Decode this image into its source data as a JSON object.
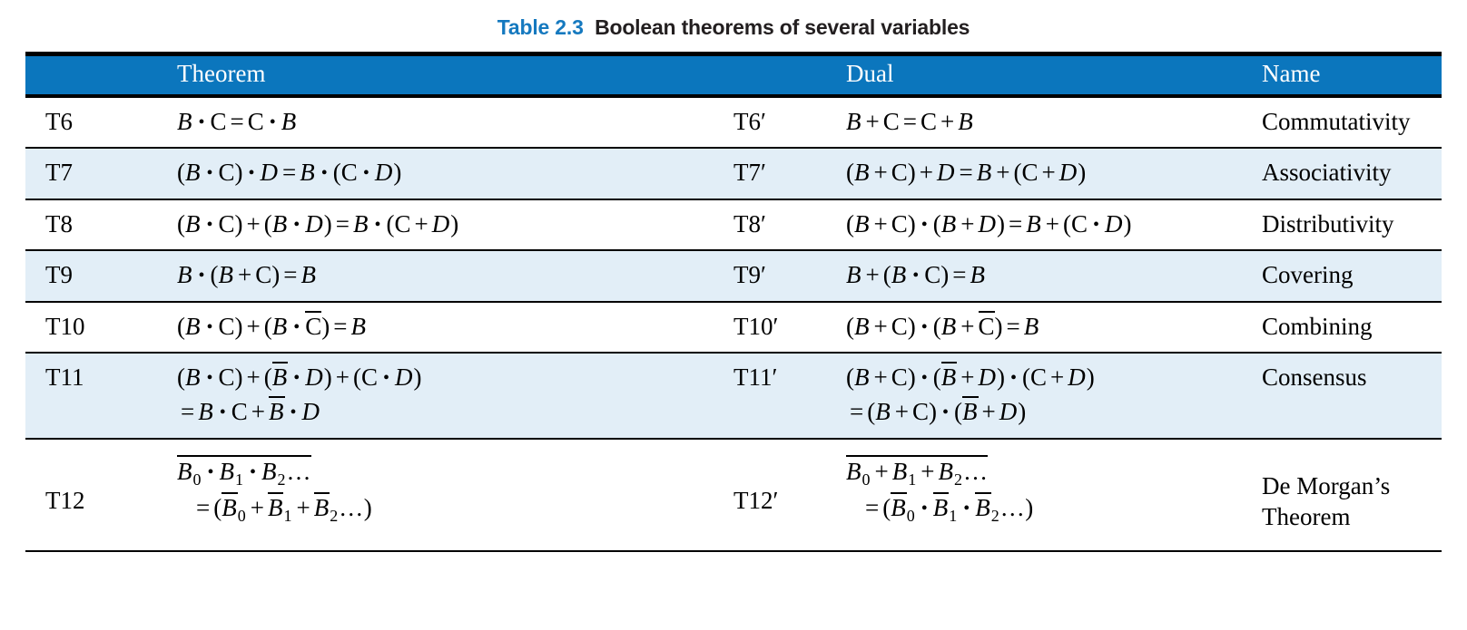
{
  "caption": {
    "number": "Table 2.3",
    "text": "Boolean theorems of several variables",
    "accent_color": "#1579bf",
    "text_color": "#231f20"
  },
  "colors": {
    "header_bg": "#0b76bd",
    "header_text": "#ffffff",
    "stripe_bg": "#e2eef7",
    "rule": "#000000",
    "body_text": "#000000"
  },
  "header": {
    "blank": "",
    "theorem": "Theorem",
    "dual_label": "",
    "dual": "Dual",
    "name": "Name"
  },
  "rows": [
    {
      "id": "T6",
      "dual_id": "T6′",
      "name": "Commutativity",
      "striped": false,
      "theorem_text": "B • C = C • B",
      "dual_text": "B + C = C + B"
    },
    {
      "id": "T7",
      "dual_id": "T7′",
      "name": "Associativity",
      "striped": true,
      "theorem_text": "(B • C) • D = B • (C • D)",
      "dual_text": "(B + C) + D = B + (C + D)"
    },
    {
      "id": "T8",
      "dual_id": "T8′",
      "name": "Distributivity",
      "striped": false,
      "theorem_text": "(B • C) + (B • D) = B • (C + D)",
      "dual_text": "(B + C) • (B + D) = B + (C • D)"
    },
    {
      "id": "T9",
      "dual_id": "T9′",
      "name": "Covering",
      "striped": true,
      "theorem_text": "B • (B + C) = B",
      "dual_text": "B + (B • C) = B"
    },
    {
      "id": "T10",
      "dual_id": "T10′",
      "name": "Combining",
      "striped": false,
      "theorem_text": "(B • C) + (B • C̅) = B",
      "dual_text": "(B + C) • (B + C̅) = B"
    },
    {
      "id": "T11",
      "dual_id": "T11′",
      "name": "Consensus",
      "striped": true,
      "theorem_text": "(B • C) + (B̅ • D) + (C • D) = B • C + B̅ • D",
      "dual_text": "(B + C) • (B̅ + D) • (C + D) = (B + C) • (B̅ + D)"
    },
    {
      "id": "T12",
      "dual_id": "T12′",
      "name": "De Morgan’s Theorem",
      "name_line1": "De Morgan’s",
      "name_line2": "Theorem",
      "striped": false,
      "theorem_text": "B₀ • B₁ • B₂… (overbar) = (B̅₀ + B̅₁ + B̅₂…)",
      "dual_text": "B₀ + B₁ + B₂… (overbar) = (B̅₀ • B̅₁ • B̅₂…)"
    }
  ],
  "symbols": {
    "and": "•",
    "or": "+",
    "eq": "=",
    "prime": "′",
    "ellipsis": "…",
    "lparen": "(",
    "rparen": ")"
  },
  "variables": [
    "B",
    "C",
    "D"
  ],
  "subscripts": [
    "0",
    "1",
    "2"
  ]
}
